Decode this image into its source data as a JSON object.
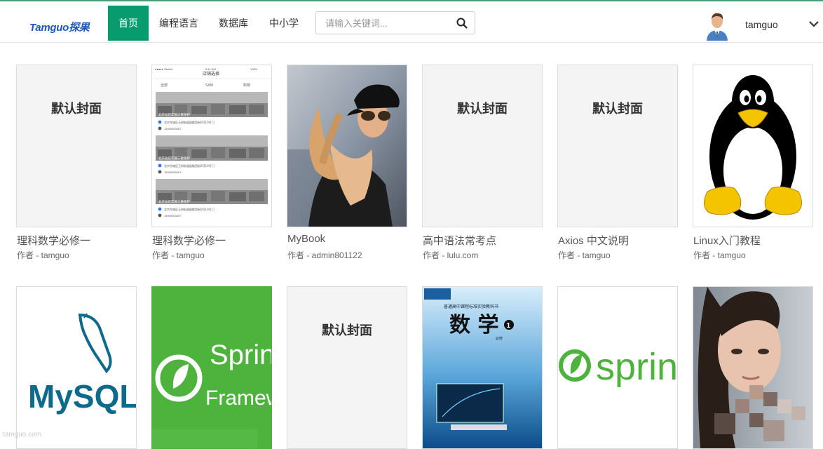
{
  "header": {
    "logo": "Tamguo探果",
    "nav": [
      {
        "label": "首页",
        "active": true
      },
      {
        "label": "编程语言"
      },
      {
        "label": "数据库"
      },
      {
        "label": "中小学"
      }
    ],
    "search_placeholder": "请输入关键词...",
    "username": "tamguo"
  },
  "books": [
    {
      "title": "理科数学必修一",
      "author": "作者 - tamguo",
      "cover": "default",
      "cover_text": "默认封面"
    },
    {
      "title": "理科数学必修一",
      "author": "作者 - tamguo",
      "cover": "phone-screenshot",
      "cover_text": {
        "status_left": "●●●●● Sketch",
        "status_time": "9:41 AM",
        "status_right": "100%",
        "nav_title": "店铺选择",
        "filters": [
          "全部",
          "SAM",
          "购物"
        ],
        "shop_name": "北京总店实施三重保护",
        "address": "北京东城区玉树街道鼓楼西街0号10号门",
        "phone": "15400000407"
      }
    },
    {
      "title": "MyBook",
      "author": "作者 - admin801122",
      "cover": "photo-woman-cap"
    },
    {
      "title": "高中语法常考点",
      "author": "作者 - lulu.com",
      "cover": "default",
      "cover_text": "默认封面"
    },
    {
      "title": "Axios 中文说明",
      "author": "作者 - tamguo",
      "cover": "default",
      "cover_text": "默认封面"
    },
    {
      "title": "Linux入门教程",
      "author": "作者 - tamguo",
      "cover": "tux"
    },
    {
      "title": "",
      "author": "",
      "cover": "mysql",
      "cover_text": "MySQL"
    },
    {
      "title": "",
      "author": "",
      "cover": "spring-framework",
      "cover_text": [
        "Spring",
        "Framework"
      ]
    },
    {
      "title": "",
      "author": "",
      "cover": "default",
      "cover_text": "默认封面"
    },
    {
      "title": "",
      "author": "",
      "cover": "math-textbook",
      "cover_text": {
        "title": "数 学",
        "badge": "1",
        "subtitle": "必修",
        "series": "普通高中课程标准实验教科书"
      }
    },
    {
      "title": "",
      "author": "",
      "cover": "spring",
      "cover_text": "spring"
    },
    {
      "title": "",
      "author": "",
      "cover": "photo-woman-portrait"
    }
  ],
  "footer_watermark": "tamguo.com",
  "colors": {
    "accent": "#079b6e",
    "logo": "#1e56b8",
    "spring_green": "#4db33d",
    "mysql_blue": "#0e6a8a",
    "mysql_orange": "#f08a1d"
  }
}
